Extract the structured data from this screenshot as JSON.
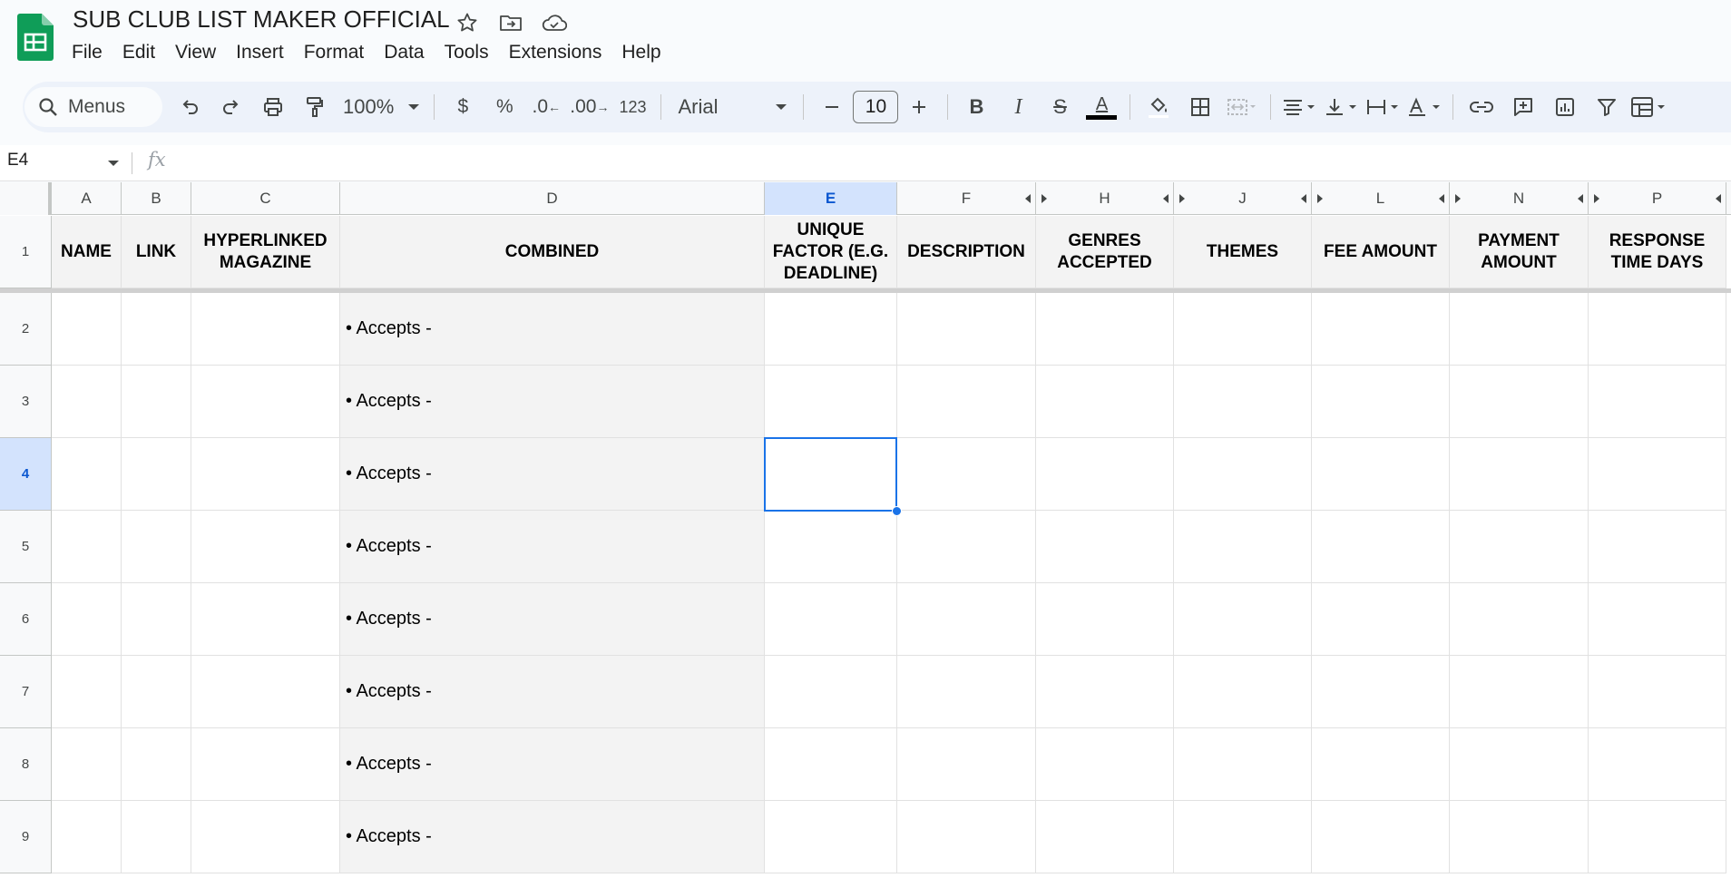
{
  "app": {
    "doc_title": "SUB CLUB LIST MAKER OFFICIAL",
    "menus": [
      "File",
      "Edit",
      "View",
      "Insert",
      "Format",
      "Data",
      "Tools",
      "Extensions",
      "Help"
    ]
  },
  "toolbar": {
    "search_label": "Menus",
    "zoom": "100%",
    "currency": "$",
    "percent": "%",
    "dec_decrease": ".0",
    "dec_increase": ".00",
    "number_format": "123",
    "font": "Arial",
    "font_size": "10",
    "bold": "B",
    "italic": "I",
    "strike": "S",
    "text_color": "A"
  },
  "formula": {
    "name_box": "E4",
    "fx_symbol": "fx"
  },
  "columns": [
    {
      "letter": "A",
      "header": "NAME"
    },
    {
      "letter": "B",
      "header": "LINK"
    },
    {
      "letter": "C",
      "header": "HYPERLINKED MAGAZINE"
    },
    {
      "letter": "D",
      "header": "COMBINED"
    },
    {
      "letter": "E",
      "header": "UNIQUE FACTOR (E.G. DEADLINE)"
    },
    {
      "letter": "F",
      "header": "DESCRIPTION"
    },
    {
      "letter": "H",
      "header": "GENRES ACCEPTED"
    },
    {
      "letter": "J",
      "header": "THEMES"
    },
    {
      "letter": "L",
      "header": "FEE AMOUNT"
    },
    {
      "letter": "N",
      "header": "PAYMENT AMOUNT"
    },
    {
      "letter": "P",
      "header": "RESPONSE TIME DAYS"
    }
  ],
  "rows": [
    {
      "num": "1"
    },
    {
      "num": "2",
      "combined": "• Accepts -"
    },
    {
      "num": "3",
      "combined": "• Accepts -"
    },
    {
      "num": "4",
      "combined": "• Accepts -"
    },
    {
      "num": "5",
      "combined": "• Accepts -"
    },
    {
      "num": "6",
      "combined": "• Accepts -"
    },
    {
      "num": "7",
      "combined": "• Accepts -"
    },
    {
      "num": "8",
      "combined": "• Accepts -"
    },
    {
      "num": "9",
      "combined": "• Accepts -"
    }
  ],
  "selection": {
    "cell": "E4"
  },
  "colors": {
    "accent": "#1a73e8",
    "header_fill": "#f3f3f3",
    "selected_header": "#d3e3fd",
    "logo_green": "#0f9d58"
  }
}
